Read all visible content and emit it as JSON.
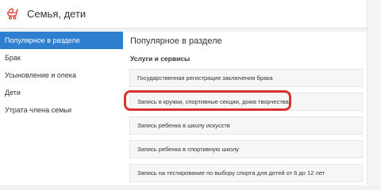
{
  "header": {
    "title": "Семья, дети",
    "icon": "baby-stroller-icon",
    "icon_color": "#e0413a"
  },
  "sidebar": {
    "active_color": "#2e7fd0",
    "items": [
      {
        "label": "Популярное в разделе",
        "active": true
      },
      {
        "label": "Брак",
        "active": false
      },
      {
        "label": "Усыновление и опека",
        "active": false
      },
      {
        "label": "Дети",
        "active": false
      },
      {
        "label": "Утрата члена семьи",
        "active": false
      }
    ]
  },
  "main": {
    "title": "Популярное в разделе",
    "section_label": "Услуги и сервисы",
    "highlight_color": "#d9342b",
    "services": [
      {
        "label": "Государственная регистрация заключения брака"
      },
      {
        "label": "Запись в кружки, спортивные секции, дома творчества",
        "highlighted": true
      },
      {
        "label": "Запись ребенка в школу искусств"
      },
      {
        "label": "Запись ребенка в спортивную школу"
      },
      {
        "label": "Запись на тестирование по выбору спорта для детей от 6 до 12 лет"
      }
    ]
  }
}
